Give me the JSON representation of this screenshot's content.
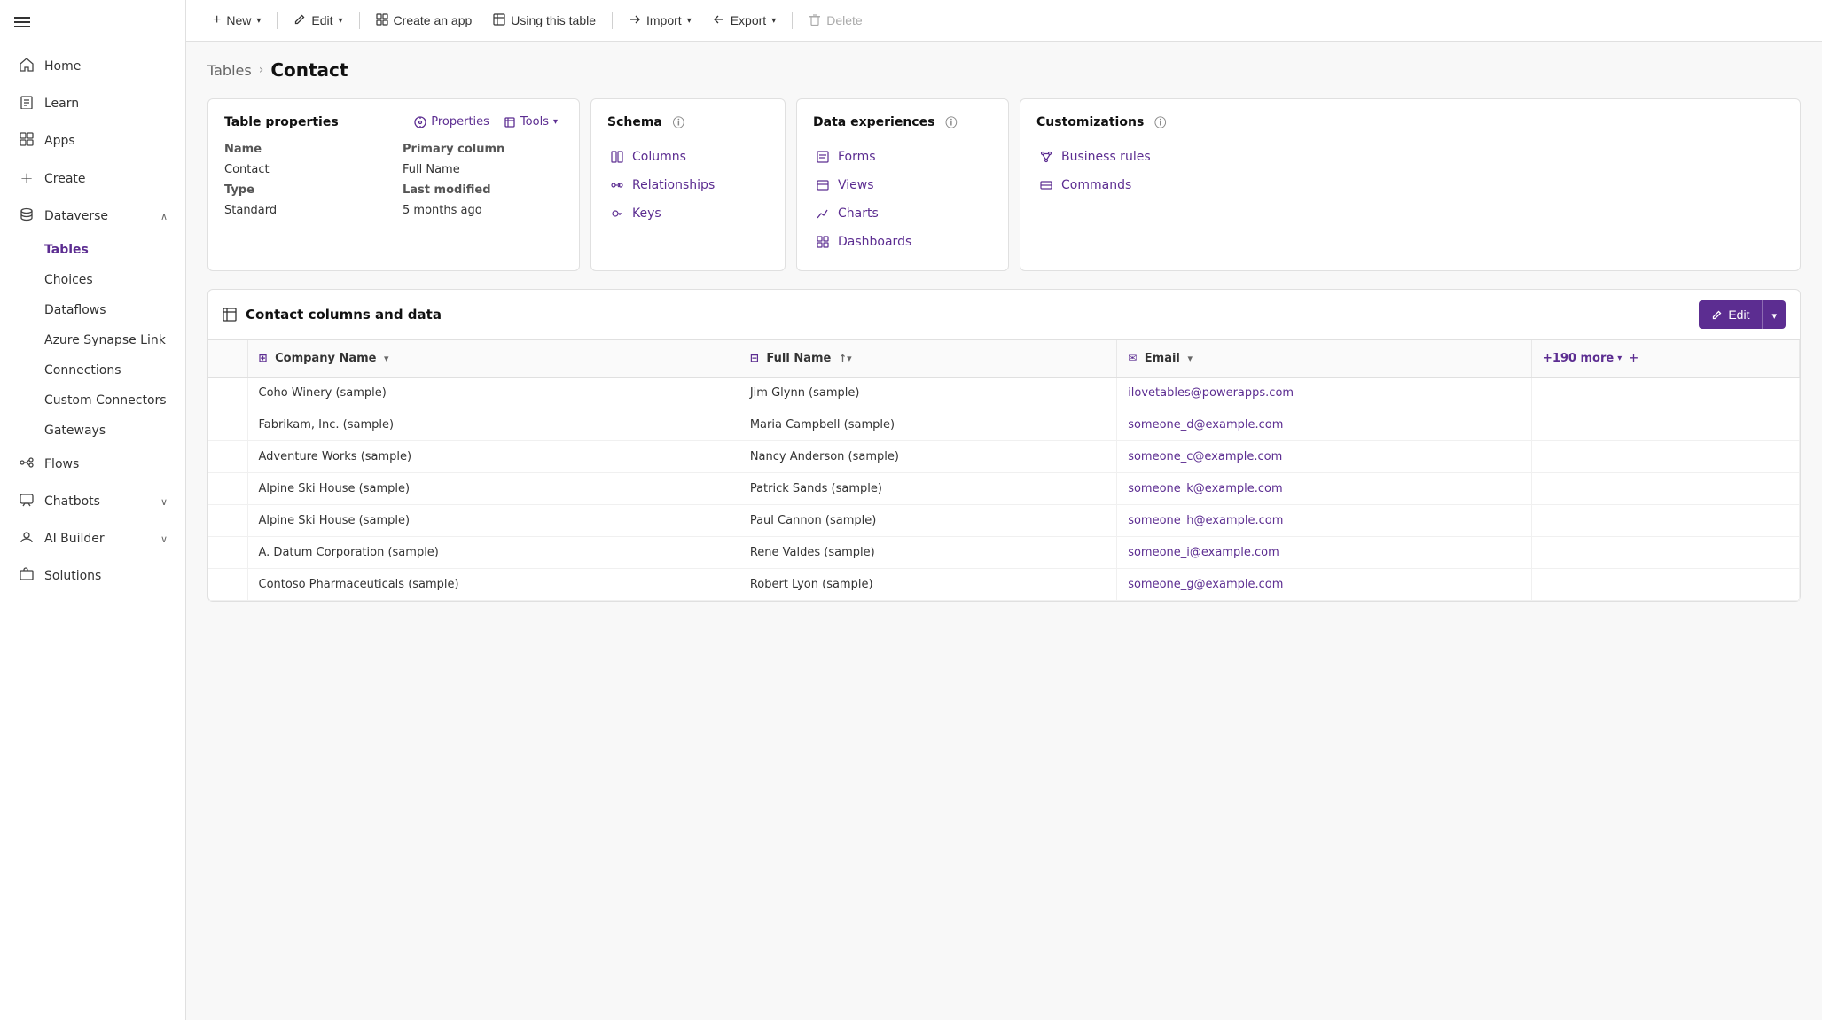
{
  "sidebar": {
    "items": [
      {
        "id": "home",
        "label": "Home",
        "icon": "🏠",
        "active": false
      },
      {
        "id": "learn",
        "label": "Learn",
        "icon": "📖",
        "active": false
      },
      {
        "id": "apps",
        "label": "Apps",
        "icon": "⊞",
        "active": false
      },
      {
        "id": "create",
        "label": "Create",
        "icon": "+",
        "active": false
      },
      {
        "id": "dataverse",
        "label": "Dataverse",
        "icon": "🗄",
        "active": false,
        "expanded": true
      },
      {
        "id": "tables",
        "label": "Tables",
        "icon": "",
        "active": true,
        "sub": true
      },
      {
        "id": "choices",
        "label": "Choices",
        "icon": "",
        "active": false,
        "sub": true
      },
      {
        "id": "dataflows",
        "label": "Dataflows",
        "icon": "",
        "active": false,
        "sub": true
      },
      {
        "id": "azure-synapse",
        "label": "Azure Synapse Link",
        "icon": "",
        "active": false,
        "sub": true
      },
      {
        "id": "connections",
        "label": "Connections",
        "icon": "",
        "active": false,
        "sub": true
      },
      {
        "id": "custom-connectors",
        "label": "Custom Connectors",
        "icon": "",
        "active": false,
        "sub": true
      },
      {
        "id": "gateways",
        "label": "Gateways",
        "icon": "",
        "active": false,
        "sub": true
      },
      {
        "id": "flows",
        "label": "Flows",
        "icon": "⇌",
        "active": false
      },
      {
        "id": "chatbots",
        "label": "Chatbots",
        "icon": "💬",
        "active": false,
        "hasChevron": true
      },
      {
        "id": "ai-builder",
        "label": "AI Builder",
        "icon": "🤖",
        "active": false,
        "hasChevron": true
      },
      {
        "id": "solutions",
        "label": "Solutions",
        "icon": "📦",
        "active": false
      }
    ]
  },
  "toolbar": {
    "new_label": "New",
    "edit_label": "Edit",
    "create_app_label": "Create an app",
    "using_table_label": "Using this table",
    "import_label": "Import",
    "export_label": "Export",
    "delete_label": "Delete"
  },
  "breadcrumb": {
    "parent": "Tables",
    "current": "Contact"
  },
  "table_props_card": {
    "title": "Table properties",
    "props_label": "Properties",
    "tools_label": "Tools",
    "name_label": "Name",
    "name_value": "Contact",
    "type_label": "Type",
    "type_value": "Standard",
    "primary_col_label": "Primary column",
    "primary_col_value": "Full Name",
    "last_modified_label": "Last modified",
    "last_modified_value": "5 months ago"
  },
  "schema_card": {
    "title": "Schema",
    "info": "ℹ",
    "items": [
      {
        "id": "columns",
        "label": "Columns",
        "icon": "⊞"
      },
      {
        "id": "relationships",
        "label": "Relationships",
        "icon": "⇄"
      },
      {
        "id": "keys",
        "label": "Keys",
        "icon": "🔑"
      }
    ]
  },
  "data_exp_card": {
    "title": "Data experiences",
    "info": "ℹ",
    "items": [
      {
        "id": "forms",
        "label": "Forms",
        "icon": "📋"
      },
      {
        "id": "views",
        "label": "Views",
        "icon": "📄"
      },
      {
        "id": "charts",
        "label": "Charts",
        "icon": "📈"
      },
      {
        "id": "dashboards",
        "label": "Dashboards",
        "icon": "⊞"
      }
    ]
  },
  "custom_card": {
    "title": "Customizations",
    "info": "ℹ",
    "items": [
      {
        "id": "business-rules",
        "label": "Business rules",
        "icon": "🔀"
      },
      {
        "id": "commands",
        "label": "Commands",
        "icon": "⊟"
      }
    ]
  },
  "data_table_section": {
    "title": "Contact columns and data",
    "edit_label": "Edit",
    "columns": [
      {
        "id": "company",
        "label": "Company Name",
        "icon": "⊞",
        "sort": "▾"
      },
      {
        "id": "fullname",
        "label": "Full Name",
        "icon": "⊟",
        "sort": "↑▾"
      },
      {
        "id": "email",
        "label": "Email",
        "icon": "✉",
        "sort": "▾"
      },
      {
        "id": "more",
        "label": "+190 more",
        "isMore": true
      }
    ],
    "rows": [
      {
        "company": "Coho Winery (sample)",
        "fullname": "Jim Glynn (sample)",
        "email": "ilovetables@powerapps.com"
      },
      {
        "company": "Fabrikam, Inc. (sample)",
        "fullname": "Maria Campbell (sample)",
        "email": "someone_d@example.com"
      },
      {
        "company": "Adventure Works (sample)",
        "fullname": "Nancy Anderson (sample)",
        "email": "someone_c@example.com"
      },
      {
        "company": "Alpine Ski House (sample)",
        "fullname": "Patrick Sands (sample)",
        "email": "someone_k@example.com"
      },
      {
        "company": "Alpine Ski House (sample)",
        "fullname": "Paul Cannon (sample)",
        "email": "someone_h@example.com"
      },
      {
        "company": "A. Datum Corporation (sample)",
        "fullname": "Rene Valdes (sample)",
        "email": "someone_i@example.com"
      },
      {
        "company": "Contoso Pharmaceuticals (sample)",
        "fullname": "Robert Lyon (sample)",
        "email": "someone_g@example.com"
      }
    ]
  }
}
